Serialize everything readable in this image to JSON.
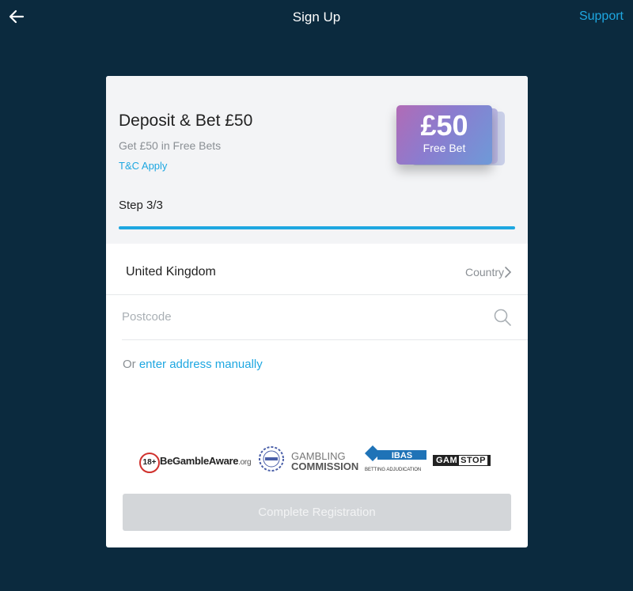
{
  "header": {
    "title": "Sign Up",
    "support_label": "Support"
  },
  "promo": {
    "title": "Deposit & Bet £50",
    "subtitle": "Get £50 in Free Bets",
    "tc_label": "T&C Apply",
    "badge_amount": "£50",
    "badge_text": "Free Bet"
  },
  "progress": {
    "label": "Step 3/3",
    "current_step": 3,
    "total_steps": 3,
    "fraction": 1.0
  },
  "form": {
    "country_value": "United Kingdom",
    "country_label": "Country",
    "postcode_placeholder": "Postcode",
    "postcode_value": "",
    "manual_prefix": "Or",
    "manual_link": "enter address manually",
    "submit_label": "Complete Registration"
  },
  "logos": {
    "age": "18+",
    "begambleaware": "BeGambleAware",
    "begambleaware_suffix": ".org",
    "gambling_commission_line1": "GAMBLING",
    "gambling_commission_line2": "COMMISSION",
    "ibas_name": "IBAS",
    "ibas_full": "BETTING ADJUDICATION",
    "gamstop_a": "GAM",
    "gamstop_b": "STOP"
  },
  "colors": {
    "background": "#0b2a3e",
    "accent": "#1ea7e1",
    "button_disabled": "#d3d6d9"
  }
}
